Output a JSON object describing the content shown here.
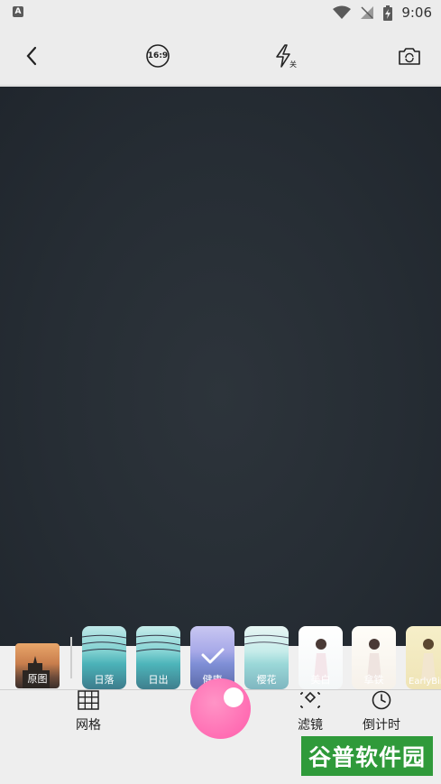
{
  "status": {
    "time": "9:06",
    "app_icon_letter": "A"
  },
  "filters": {
    "original": {
      "label": "原图"
    },
    "items": [
      {
        "label": "日落"
      },
      {
        "label": "日出"
      },
      {
        "label": "健康"
      },
      {
        "label": "樱花"
      },
      {
        "label": "美白"
      },
      {
        "label": "拿铁"
      },
      {
        "label": "EarlyBird"
      }
    ]
  },
  "tools": {
    "grid_label": "网格",
    "filter_label": "滤镜",
    "countdown_label": "倒计时"
  },
  "topbar": {
    "ratio_label": "16:9"
  },
  "watermark": {
    "text": "谷普软件园"
  },
  "colors": {
    "shutter": "#ff6db3",
    "watermark_bg": "#2f9a3a"
  }
}
